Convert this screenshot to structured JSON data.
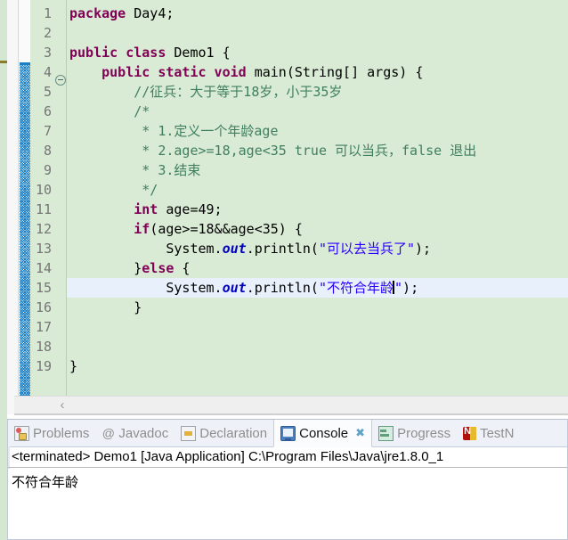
{
  "editor": {
    "gutter_numbers": [
      "1",
      "2",
      "3",
      "4",
      "5",
      "6",
      "7",
      "8",
      "9",
      "10",
      "11",
      "12",
      "13",
      "14",
      "15",
      "16",
      "17",
      "18",
      "19"
    ],
    "lines": [
      {
        "n": 1,
        "selected": false,
        "tokens": [
          {
            "t": "kw",
            "v": "package"
          },
          {
            "t": "plain",
            "v": " Day4;"
          }
        ]
      },
      {
        "n": 2,
        "selected": false,
        "tokens": []
      },
      {
        "n": 3,
        "selected": false,
        "tokens": [
          {
            "t": "kw",
            "v": "public class"
          },
          {
            "t": "plain",
            "v": " Demo1 {"
          }
        ]
      },
      {
        "n": 4,
        "selected": false,
        "tokens": [
          {
            "t": "plain",
            "v": "    "
          },
          {
            "t": "kw",
            "v": "public static void"
          },
          {
            "t": "plain",
            "v": " main(String[] args) {"
          }
        ]
      },
      {
        "n": 5,
        "selected": false,
        "tokens": [
          {
            "t": "plain",
            "v": "        "
          },
          {
            "t": "cmt",
            "v": "//征兵：大于等于18岁，小于35岁"
          }
        ]
      },
      {
        "n": 6,
        "selected": false,
        "tokens": [
          {
            "t": "plain",
            "v": "        "
          },
          {
            "t": "cmt",
            "v": "/*"
          }
        ]
      },
      {
        "n": 7,
        "selected": false,
        "tokens": [
          {
            "t": "plain",
            "v": "         "
          },
          {
            "t": "cmt",
            "v": "* 1.定义一个年龄age"
          }
        ]
      },
      {
        "n": 8,
        "selected": false,
        "tokens": [
          {
            "t": "plain",
            "v": "         "
          },
          {
            "t": "cmt",
            "v": "* 2.age>=18,age<35 true 可以当兵，false 退出"
          }
        ]
      },
      {
        "n": 9,
        "selected": false,
        "tokens": [
          {
            "t": "plain",
            "v": "         "
          },
          {
            "t": "cmt",
            "v": "* 3.结束"
          }
        ]
      },
      {
        "n": 10,
        "selected": false,
        "tokens": [
          {
            "t": "plain",
            "v": "         "
          },
          {
            "t": "cmt",
            "v": "*/"
          }
        ]
      },
      {
        "n": 11,
        "selected": false,
        "tokens": [
          {
            "t": "plain",
            "v": "        "
          },
          {
            "t": "kw",
            "v": "int"
          },
          {
            "t": "plain",
            "v": " age=49;"
          }
        ]
      },
      {
        "n": 12,
        "selected": false,
        "tokens": [
          {
            "t": "plain",
            "v": "        "
          },
          {
            "t": "kw",
            "v": "if"
          },
          {
            "t": "plain",
            "v": "(age>=18&&age<35) {"
          }
        ]
      },
      {
        "n": 13,
        "selected": false,
        "tokens": [
          {
            "t": "plain",
            "v": "            System."
          },
          {
            "t": "fld",
            "v": "out"
          },
          {
            "t": "plain",
            "v": ".println("
          },
          {
            "t": "str",
            "v": "\"可以去当兵了\""
          },
          {
            "t": "plain",
            "v": ");"
          }
        ]
      },
      {
        "n": 14,
        "selected": false,
        "tokens": [
          {
            "t": "plain",
            "v": "        }"
          },
          {
            "t": "kw",
            "v": "else"
          },
          {
            "t": "plain",
            "v": " {"
          }
        ]
      },
      {
        "n": 15,
        "selected": true,
        "tokens": [
          {
            "t": "plain",
            "v": "            System."
          },
          {
            "t": "fld",
            "v": "out"
          },
          {
            "t": "plain",
            "v": ".println("
          },
          {
            "t": "str",
            "v": "\"不符合年龄"
          },
          {
            "t": "caret",
            "v": ""
          },
          {
            "t": "str",
            "v": "\""
          },
          {
            "t": "plain",
            "v": ");"
          }
        ]
      },
      {
        "n": 16,
        "selected": false,
        "tokens": [
          {
            "t": "plain",
            "v": "        }"
          }
        ]
      },
      {
        "n": 17,
        "selected": false,
        "tokens": []
      },
      {
        "n": 18,
        "selected": false,
        "tokens": []
      },
      {
        "n": 19,
        "selected": false,
        "tokens": [
          {
            "t": "plain",
            "v": "}"
          }
        ]
      }
    ],
    "scroll_left_arrow": "‹"
  },
  "bottom_view": {
    "tabs": [
      {
        "label": "Problems",
        "icon": "problems-icon",
        "active": false,
        "closable": false
      },
      {
        "label": "Javadoc",
        "icon": "javadoc-icon",
        "active": false,
        "closable": false
      },
      {
        "label": "Declaration",
        "icon": "declaration-icon",
        "active": false,
        "closable": false
      },
      {
        "label": "Console",
        "icon": "console-icon",
        "active": true,
        "closable": true
      },
      {
        "label": "Progress",
        "icon": "progress-icon",
        "active": false,
        "closable": false
      },
      {
        "label": "TestN",
        "icon": "testng-icon",
        "active": false,
        "closable": false
      }
    ],
    "close_glyph": "✖",
    "console": {
      "status_line": "<terminated> Demo1 [Java Application] C:\\Program Files\\Java\\jre1.8.0_1",
      "output": "不符合年龄"
    }
  },
  "colors": {
    "editor_background": "#d9ead5",
    "selected_line": "#e8f0fc",
    "keyword": "#7f0055",
    "comment": "#3f7f5f",
    "string": "#2a00ff",
    "field": "#0000c0",
    "change_bar": "#1a7fc4",
    "workspace_strip": "#d4e7d0"
  }
}
